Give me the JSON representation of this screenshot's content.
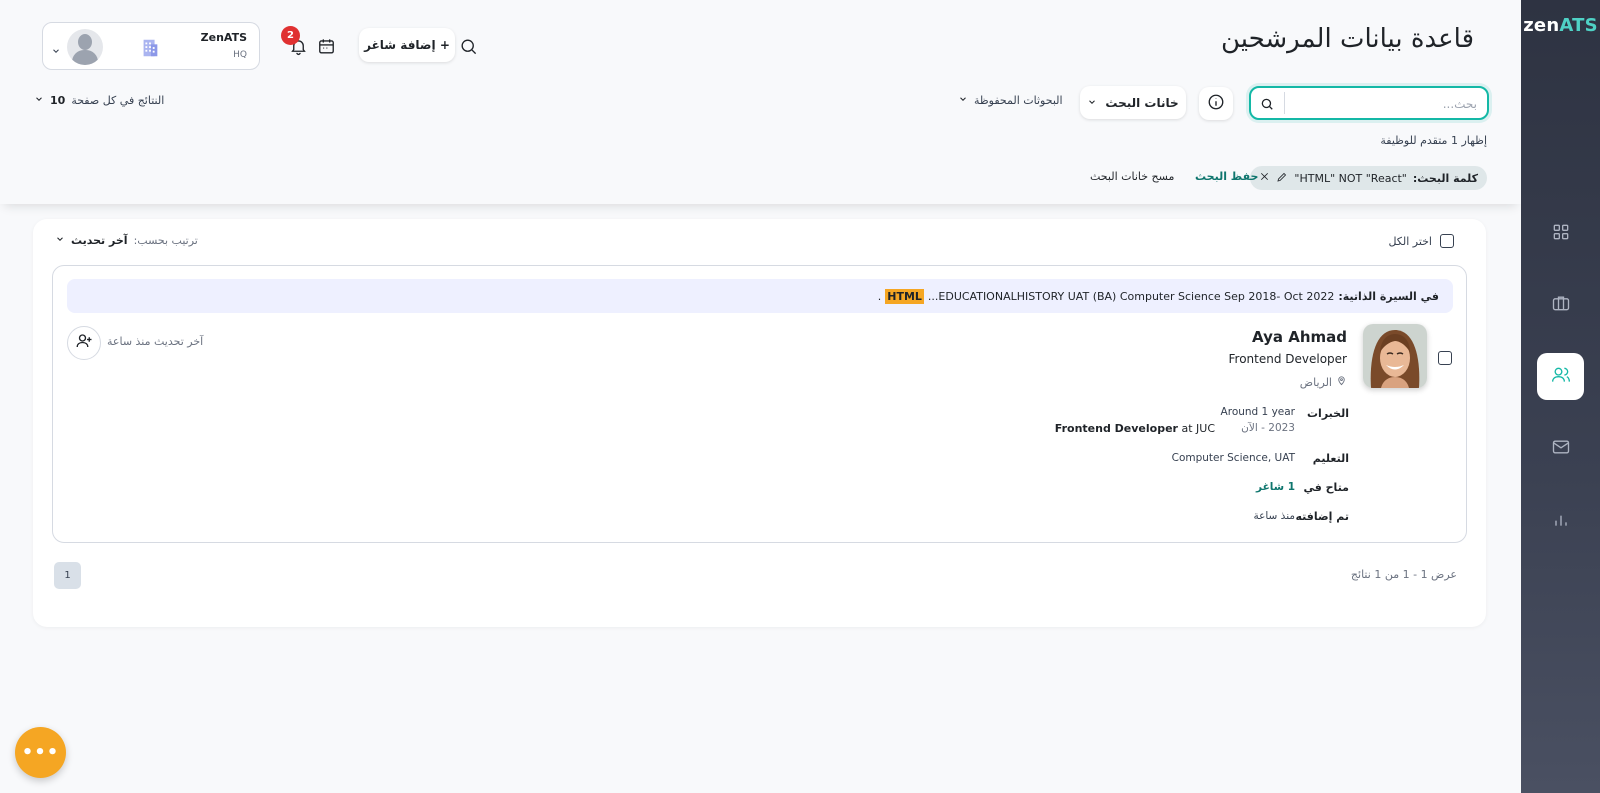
{
  "brand": {
    "prefix": "zen",
    "suffix": "ATS"
  },
  "header": {
    "title": "قاعدة بيانات المرشحين",
    "add_vacancy": "+ إضافة شاغر",
    "notification_count": "2",
    "org": {
      "name": "ZenATS",
      "sub": "HQ"
    }
  },
  "search": {
    "placeholder": "بحث...",
    "fields_label": "خانات البحث",
    "saved_label": "البحوثات المحفوظة",
    "per_page_label": "النتائج في كل صفحة",
    "per_page_value": "10",
    "showing": "إظهار 1 متقدم للوظيفة",
    "chip_label": "كلمة البحث:",
    "chip_value": "\"HTML\" NOT \"React\"",
    "save_search": "حفظ البحث",
    "clear_fields": "مسح خانات البحث"
  },
  "results": {
    "sort_label": "ترتيب بحسب:",
    "sort_value": "آخر تحديث",
    "select_all": "اختر الكل",
    "candidate": {
      "cv_label": "في السيرة الذاتية:",
      "cv_snippet": "...EDUCATIONALHISTORY UAT (BA) Computer Science Sep 2018- Oct 2022",
      "cv_highlight": "HTML",
      "cv_trailing": ".",
      "name": "Aya Ahmad",
      "title": "Frontend Developer",
      "location": "الرياض",
      "experience_label": "الخبرات",
      "experience_duration": "Around 1 year",
      "experience_dates": "2023 - الآن",
      "experience_role": "Frontend Developer",
      "experience_at": "at JUC",
      "education_label": "التعليم",
      "education_value": "Computer Science, UAT",
      "available_label": "متاح في",
      "available_value": "1 شاغر",
      "added_label": "تم إضافته",
      "added_value": "منذ ساعة",
      "updated": "آخر تحديث منذ ساعة"
    },
    "page": "1",
    "count_text": "عرض 1 - 1 من 1 نتائج"
  },
  "fab_label": "•••"
}
